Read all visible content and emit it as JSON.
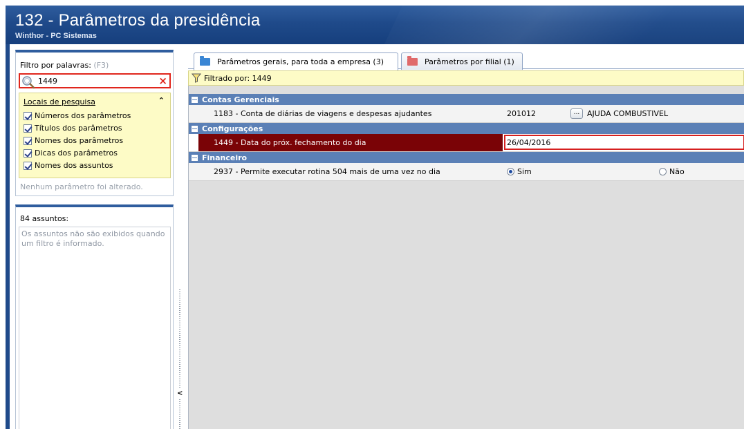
{
  "window": {
    "title": "132 - Parâmetros da presidência",
    "subtitle": "Winthor - PC Sistemas"
  },
  "filter": {
    "label": "Filtro por palavras:",
    "shortcut": "(F3)",
    "value": "1449",
    "clear_icon": "×",
    "locais_title": "Locais de pesquisa",
    "collapse_icon": "⌃",
    "options": [
      {
        "label": "Números dos parâmetros",
        "checked": true
      },
      {
        "label": "Títulos dos parâmetros",
        "checked": true
      },
      {
        "label": "Nomes dos parâmetros",
        "checked": true
      },
      {
        "label": "Dicas dos parâmetros",
        "checked": true
      },
      {
        "label": "Nomes dos assuntos",
        "checked": true
      }
    ],
    "status": "Nenhum parâmetro foi alterado."
  },
  "subjects": {
    "count_label": "84 assuntos:",
    "message": "Os assuntos não são exibidos quando um filtro é informado."
  },
  "splitter": {
    "arrow": "<"
  },
  "tabs": [
    {
      "label": "Parâmetros gerais, para toda a empresa (3)",
      "active": true,
      "icon": "folder-blue-icon"
    },
    {
      "label": "Parâmetros por filial (1)",
      "active": false,
      "icon": "folder-red-icon"
    }
  ],
  "filterbar": {
    "text": "Filtrado por: 1449"
  },
  "groups": [
    {
      "name": "Contas Gerenciais",
      "rows": [
        {
          "param": "1183 - Conta de diárias de viagens e despesas ajudantes",
          "code": "201012",
          "button": "...",
          "desc": "AJUDA COMBUSTIVEL"
        }
      ]
    },
    {
      "name": "Configurações",
      "rows": [
        {
          "param": "1449 - Data do próx. fechamento do dia",
          "value": "26/04/2016"
        }
      ]
    },
    {
      "name": "Financeiro",
      "rows": [
        {
          "param": "2937 - Permite executar rotina 504 mais de uma vez no dia",
          "option_yes": "Sim",
          "option_no": "Não",
          "selected": "Sim"
        }
      ]
    }
  ],
  "colors": {
    "title_bar": "#1f4a8a",
    "group_header": "#5b80b6",
    "selected_row": "#7a0306",
    "highlight_yellow": "#fdfbc6",
    "alert_red": "#e0261c"
  }
}
